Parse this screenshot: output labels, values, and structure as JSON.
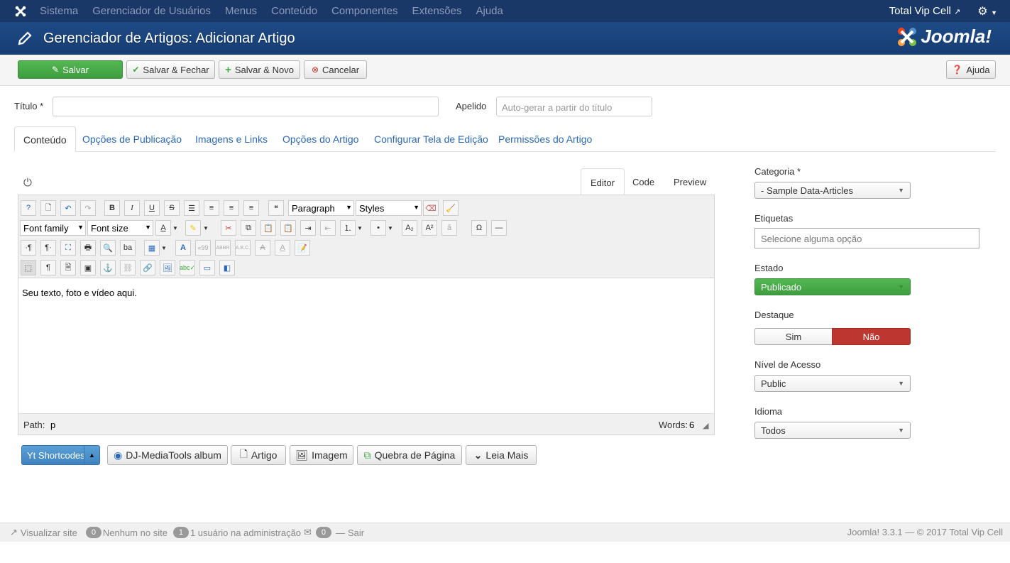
{
  "topnav": {
    "menu": [
      "Sistema",
      "Gerenciador de Usuários",
      "Menus",
      "Conteúdo",
      "Componentes",
      "Extensões",
      "Ajuda"
    ],
    "site_name": "Total Vip Cell"
  },
  "header": {
    "title": "Gerenciador de Artigos: Adicionar Artigo",
    "brand": "Joomla!"
  },
  "toolbar": {
    "save": "Salvar",
    "save_close": "Salvar & Fechar",
    "save_new": "Salvar & Novo",
    "cancel": "Cancelar",
    "help": "Ajuda"
  },
  "form": {
    "title_label": "Título *",
    "title_value": "",
    "alias_label": "Apelido",
    "alias_placeholder": "Auto-gerar a partir do título"
  },
  "tabs": [
    "Conteúdo",
    "Opções de Publicação",
    "Imagens e Links",
    "Opções do Artigo",
    "Configurar Tela de Edição",
    "Permissões do Artigo"
  ],
  "editor_tabs": [
    "Editor",
    "Code",
    "Preview"
  ],
  "editor": {
    "paragraph": "Paragraph",
    "styles": "Styles",
    "font_family": "Font family",
    "font_size": "Font size",
    "content": "Seu texto, foto e vídeo aqui.",
    "path_label": "Path:",
    "path_value": "p",
    "words_label": "Words:",
    "words_value": "6"
  },
  "buttons": {
    "shortcodes": "Yt Shortcodes",
    "djmedia": "DJ-MediaTools album",
    "artigo": "Artigo",
    "imagem": "Imagem",
    "quebra": "Quebra de Página",
    "leia": "Leia Mais"
  },
  "sidebar": {
    "categoria_label": "Categoria *",
    "categoria_value": "- Sample Data-Articles",
    "etiquetas_label": "Etiquetas",
    "etiquetas_placeholder": "Selecione alguma opção",
    "estado_label": "Estado",
    "estado_value": "Publicado",
    "destaque_label": "Destaque",
    "destaque_sim": "Sim",
    "destaque_nao": "Não",
    "nivel_label": "Nível de Acesso",
    "nivel_value": "Public",
    "idioma_label": "Idioma",
    "idioma_value": "Todos"
  },
  "footer": {
    "view_site": "Visualizar site",
    "badge_site": "0",
    "none_site": "Nenhum no site",
    "badge_admin": "1",
    "admin_users": "1 usuário na administração",
    "badge_msg": "0",
    "logout": "Sair",
    "version": "Joomla! 3.3.1 — © 2017 Total Vip Cell"
  },
  "colors": {
    "navbar": "#1a3867",
    "header": "#1d4a86",
    "green": "#46a546",
    "red": "#bd362f",
    "link": "#2a69b8"
  }
}
